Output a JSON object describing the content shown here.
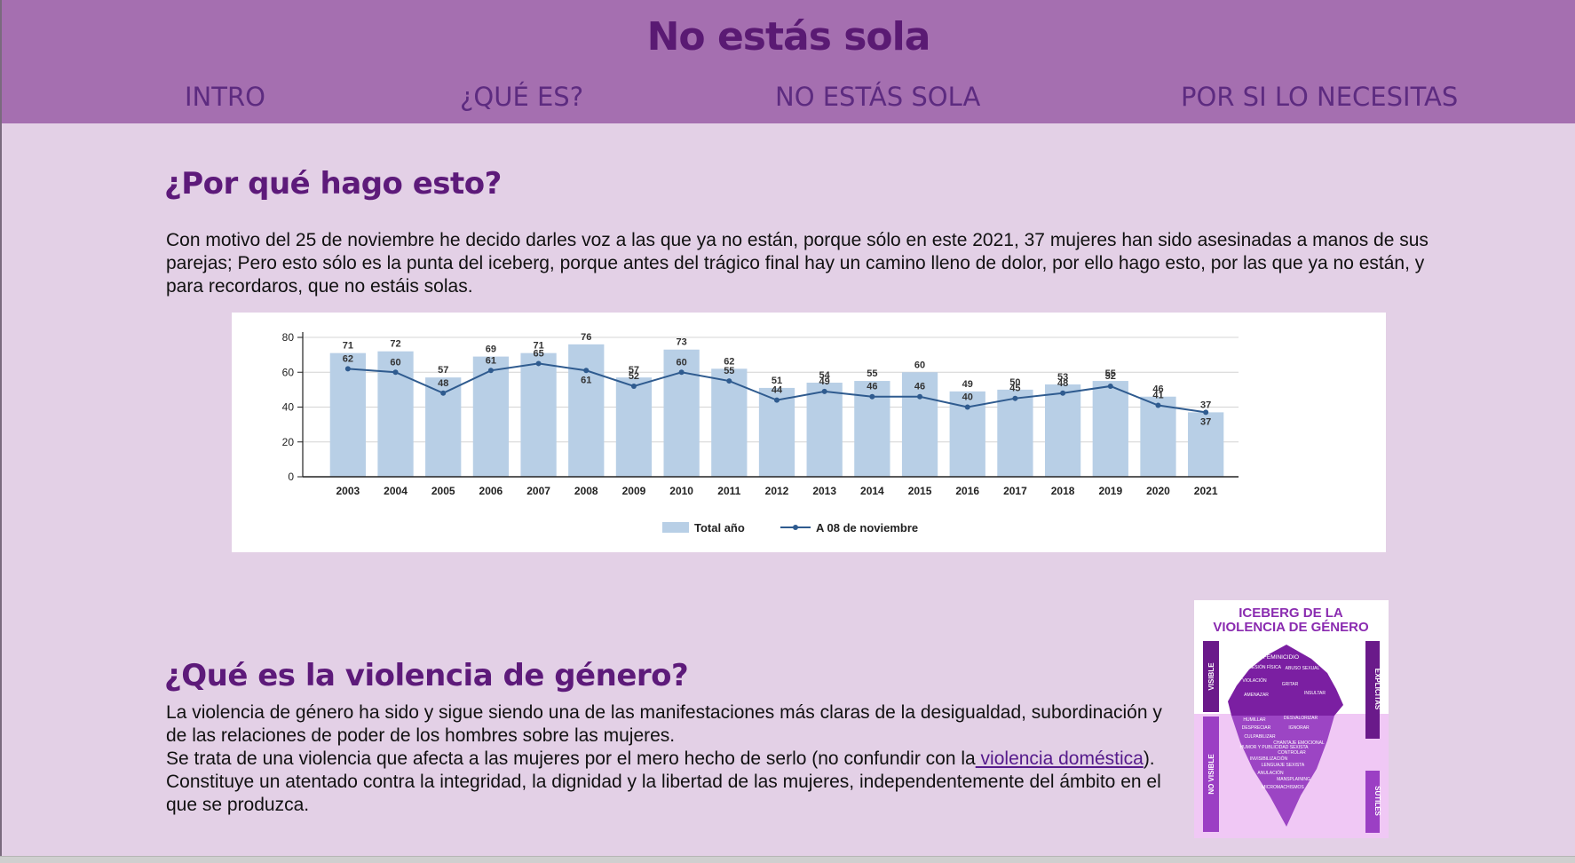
{
  "header": {
    "title": "No estás sola",
    "nav": [
      {
        "label": "INTRO"
      },
      {
        "label": "¿QUÉ ES?"
      },
      {
        "label": "NO ESTÁS SOLA"
      },
      {
        "label": "POR SI LO NECESITAS"
      }
    ]
  },
  "section1": {
    "heading": "¿Por qué hago esto?",
    "text": "Con motivo del 25 de noviembre he decido darles voz a las que ya no están, porque sólo en este 2021, 37 mujeres han sido asesinadas a manos de sus parejas; Pero esto sólo es la punta del iceberg, porque antes del trágico final hay un camino lleno de dolor, por ello hago esto, por las que ya no están, y para recordaros, que no estáis solas."
  },
  "chart_data": {
    "type": "bar",
    "categories": [
      "2003",
      "2004",
      "2005",
      "2006",
      "2007",
      "2008",
      "2009",
      "2010",
      "2011",
      "2012",
      "2013",
      "2014",
      "2015",
      "2016",
      "2017",
      "2018",
      "2019",
      "2020",
      "2021"
    ],
    "series": [
      {
        "name": "Total año",
        "type": "bar",
        "values": [
          71,
          72,
          57,
          69,
          71,
          76,
          57,
          73,
          62,
          51,
          54,
          55,
          60,
          49,
          50,
          53,
          55,
          46,
          37
        ]
      },
      {
        "name": "A 08 de noviembre",
        "type": "line",
        "values": [
          62,
          60,
          48,
          61,
          65,
          61,
          52,
          60,
          55,
          44,
          49,
          46,
          46,
          40,
          45,
          48,
          52,
          41,
          37
        ]
      }
    ],
    "yticks": [
      0,
      20,
      40,
      60,
      80
    ],
    "ylim": [
      0,
      80
    ],
    "legend": "bottom",
    "colors": {
      "bar": "#b8cfe6",
      "line": "#2f5b8f"
    }
  },
  "section2": {
    "heading": "¿Qué es la violencia de género?",
    "text1": "La violencia de género ha sido y sigue siendo una de las manifestaciones más claras de la desigualdad, subordinación y de las relaciones de poder de los hombres sobre las mujeres.",
    "text2_before": "Se trata de una violencia que afecta a las mujeres por el mero hecho de serlo (no confundir con la",
    "link": " violencia doméstica",
    "text2_after": "). Constituye un atentado contra la integridad, la dignidad y la libertad de las mujeres, independentemente del ámbito en el que se produzca."
  },
  "iceberg": {
    "title_line1": "ICEBERG DE LA",
    "title_line2": "VIOLENCIA DE GÉNERO",
    "side_left_top": "VISIBLE",
    "side_left_bottom": "NO VISIBLE",
    "side_right_top": "EXPLÍCITAS",
    "side_right_bottom": "SUTILES",
    "visible_items": [
      "FEMINICIDIO",
      "AGRESIÓN FÍSICA",
      "ABUSO SEXUAL",
      "VIOLACIÓN",
      "GRITAR",
      "AMENAZAR",
      "INSULTAR"
    ],
    "hidden_items": [
      "HUMILLAR",
      "DESVALORIZAR",
      "DESPRECIAR",
      "IGNORAR",
      "CULPABILIZAR",
      "CHANTAJE EMOCIONAL",
      "HUMOR Y PUBLICIDAD SEXISTA",
      "CONTROLAR",
      "INVISIBILIZACIÓN",
      "LENGUAJE SEXISTA",
      "ANULACIÓN",
      "MANSPLAINING",
      "MICROMACHISMOS"
    ]
  }
}
